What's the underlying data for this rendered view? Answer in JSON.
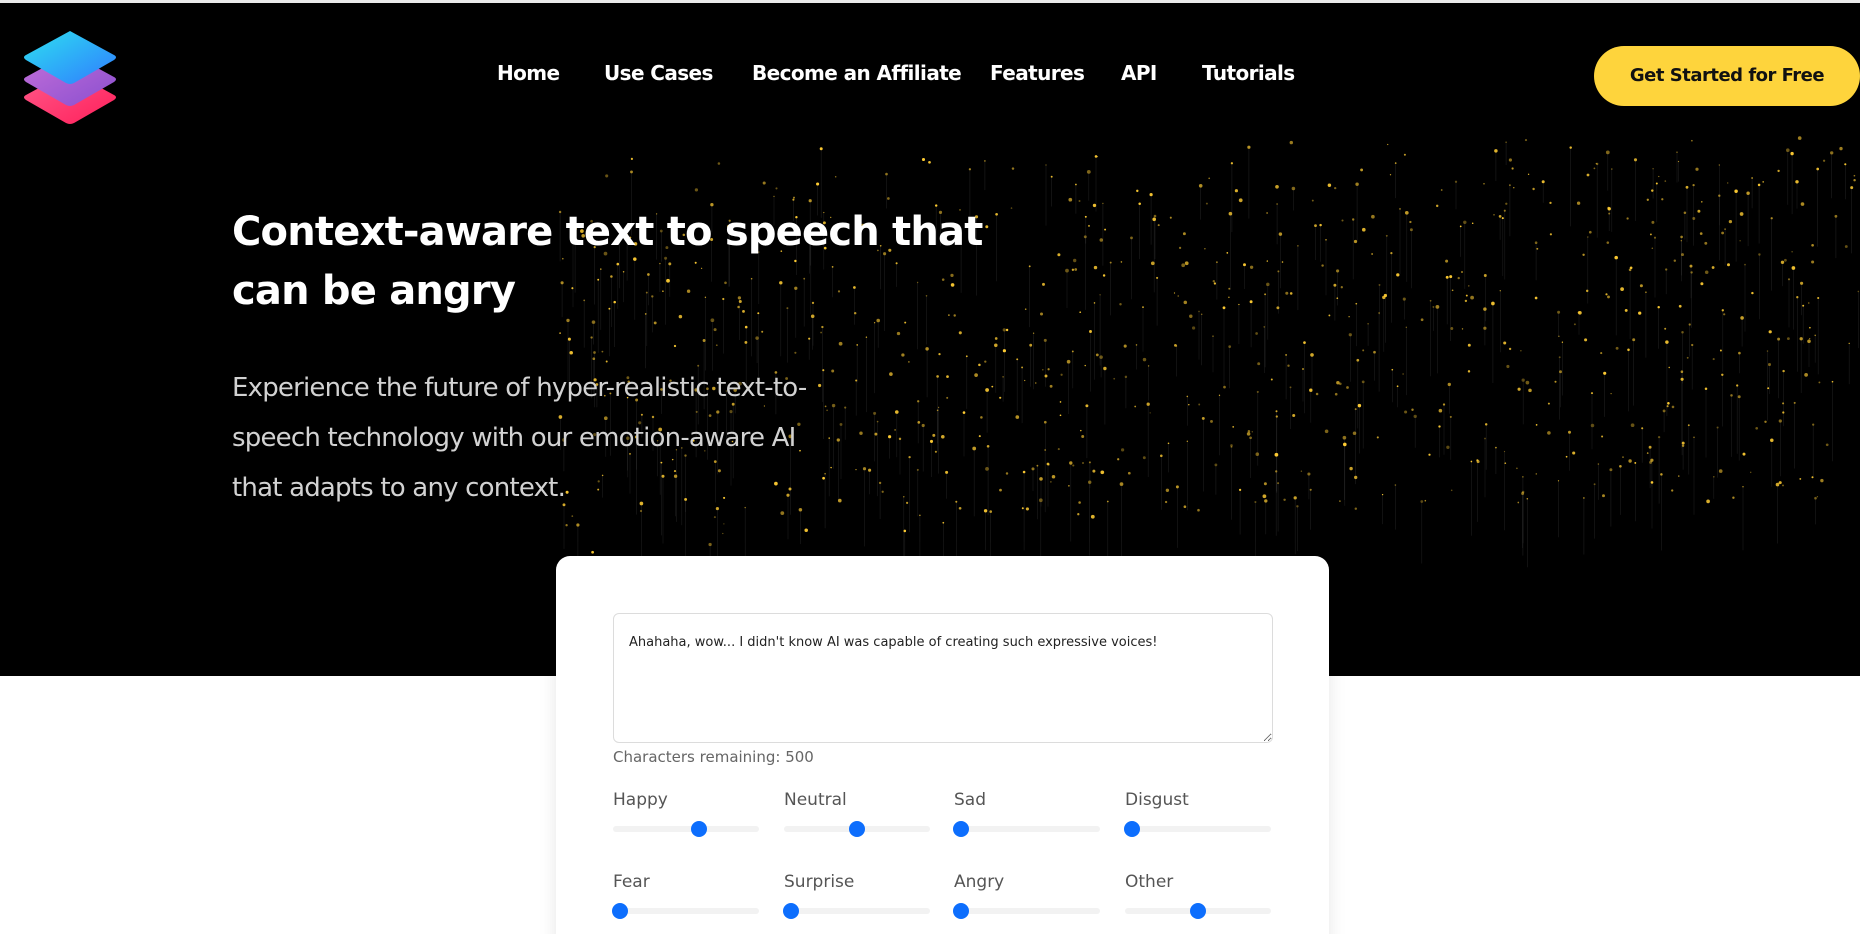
{
  "nav": {
    "items": [
      "Home",
      "Use Cases",
      "Become an Affiliate",
      "Features",
      "API",
      "Tutorials"
    ],
    "cta": "Get Started for Free"
  },
  "hero": {
    "headline_line1": "Context-aware text to speech that",
    "headline_line2": "can be angry",
    "sub_line1": "Experience the future of hyper-realistic text-to-",
    "sub_line2": "speech technology with our emotion-aware AI",
    "sub_line3": "that adapts to any context."
  },
  "generator": {
    "text_value": "Ahahaha, wow... I didn't know AI was capable of creating such expressive voices!",
    "counter": "Characters remaining: 500",
    "emotions": [
      {
        "label": "Happy",
        "value": 0.59
      },
      {
        "label": "Neutral",
        "value": 0.5
      },
      {
        "label": "Sad",
        "value": 0.05
      },
      {
        "label": "Disgust",
        "value": 0.05
      },
      {
        "label": "Fear",
        "value": 0.05
      },
      {
        "label": "Surprise",
        "value": 0.05
      },
      {
        "label": "Angry",
        "value": 0.05
      },
      {
        "label": "Other",
        "value": 0.5
      }
    ]
  },
  "colors": {
    "hero_bg": "#000000",
    "cta_bg": "#fed43c",
    "slider_thumb": "#0d6efd",
    "particle": "#ffcc33"
  },
  "icons": {
    "logo": "layered-stack-logo-icon"
  }
}
